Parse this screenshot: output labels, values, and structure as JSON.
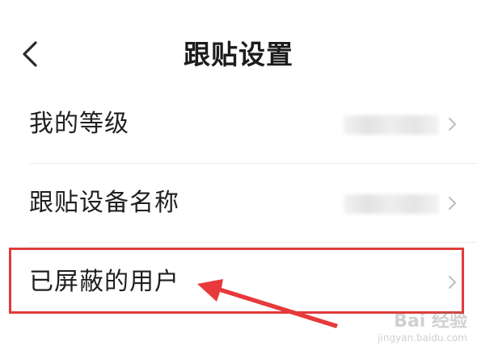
{
  "header": {
    "title": "跟贴设置",
    "back_icon": "chevron-left-icon"
  },
  "list": {
    "items": [
      {
        "label": "我的等级",
        "value_blurred": true
      },
      {
        "label": "跟贴设备名称",
        "value_blurred": true
      },
      {
        "label": "已屏蔽的用户",
        "value_blurred": false
      }
    ],
    "chevron_icon": "chevron-right-icon"
  },
  "annotation": {
    "highlight_color": "#e03b3b",
    "arrow_color": "#e8393c"
  },
  "watermark": {
    "main": "Bai 经验",
    "sub": "jingyan.baidu.com"
  }
}
